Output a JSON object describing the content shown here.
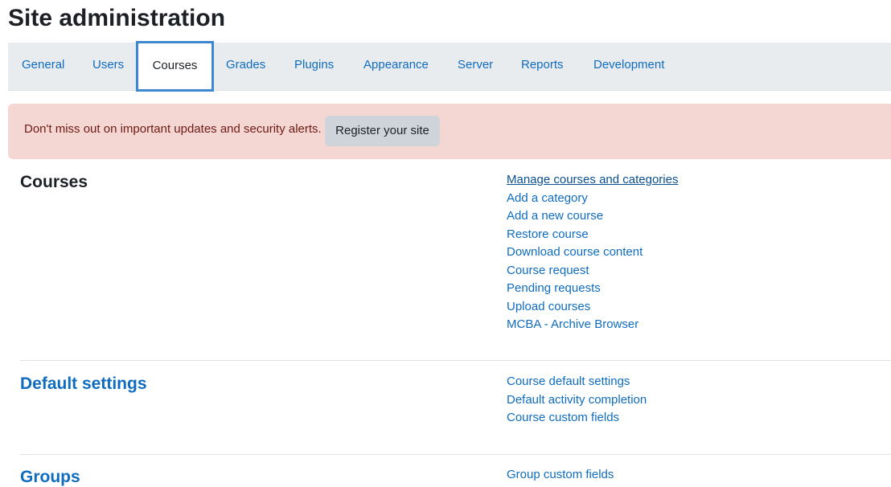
{
  "page": {
    "title": "Site administration"
  },
  "tabs": [
    {
      "label": "General"
    },
    {
      "label": "Users"
    },
    {
      "label": "Courses"
    },
    {
      "label": "Grades"
    },
    {
      "label": "Plugins"
    },
    {
      "label": "Appearance"
    },
    {
      "label": "Server"
    },
    {
      "label": "Reports"
    },
    {
      "label": "Development"
    }
  ],
  "active_tab": "Courses",
  "alert": {
    "message": "Don't miss out on important updates and security alerts.",
    "button_label": "Register your site"
  },
  "sections": [
    {
      "title": "Courses",
      "links": [
        "Manage courses and categories",
        "Add a category",
        "Add a new course",
        "Restore course",
        "Download course content",
        "Course request",
        "Pending requests",
        "Upload courses",
        "MCBA - Archive Browser"
      ]
    },
    {
      "title": "Default settings",
      "links": [
        "Course default settings",
        "Default activity completion",
        "Course custom fields"
      ]
    },
    {
      "title": "Groups",
      "links": [
        "Group custom fields"
      ]
    }
  ],
  "colors": {
    "link": "#0f6cbf",
    "tabbar_bg": "#e9ecef",
    "active_tab_border": "#3d88d0",
    "alert_bg": "#f4d6d2",
    "alert_text": "#6e1a14"
  }
}
